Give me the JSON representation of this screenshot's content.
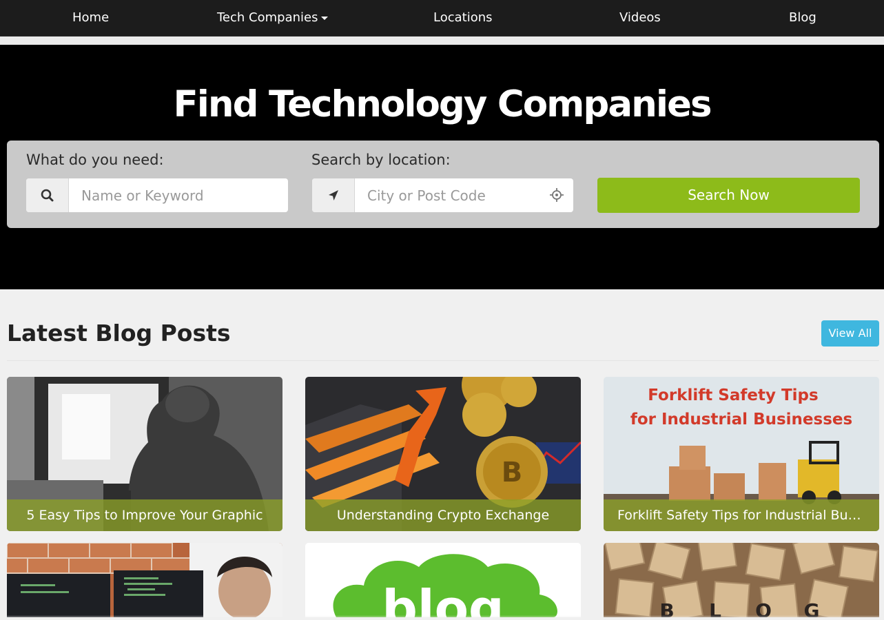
{
  "nav": {
    "items": [
      {
        "label": "Home"
      },
      {
        "label": "Tech Companies",
        "has_dropdown": true
      },
      {
        "label": "Locations"
      },
      {
        "label": "Videos"
      },
      {
        "label": "Blog"
      }
    ]
  },
  "hero": {
    "title": "Find Technology Companies",
    "search": {
      "need_label": "What do you need:",
      "keyword_placeholder": "Name or Keyword",
      "keyword_value": "",
      "location_label": "Search by location:",
      "location_placeholder": "City or Post Code",
      "location_value": "",
      "button_label": "Search Now"
    }
  },
  "blog": {
    "section_title": "Latest Blog Posts",
    "view_all_label": "View All",
    "posts": [
      {
        "title": "5 Easy Tips to Improve Your Graphic"
      },
      {
        "title": "Understanding Crypto Exchange"
      },
      {
        "title": "Forklift Safety Tips for Industrial Businesses",
        "image_text": [
          "Forklift Safety Tips",
          "for Industrial Businesses"
        ]
      }
    ],
    "more_posts": [
      {
        "image_text": "blog"
      },
      {
        "image_text": "BLOG"
      }
    ]
  },
  "colors": {
    "nav_bg": "#1c1c1c",
    "hero_bg": "#000000",
    "search_button": "#8dbb1a",
    "view_all_button": "#3fb7df",
    "caption_overlay": "#8ca028"
  },
  "icons": {
    "keyword_addon": "search-icon",
    "location_addon": "location-arrow-icon",
    "locate_button": "crosshair-icon",
    "dropdown": "caret-down-icon"
  }
}
